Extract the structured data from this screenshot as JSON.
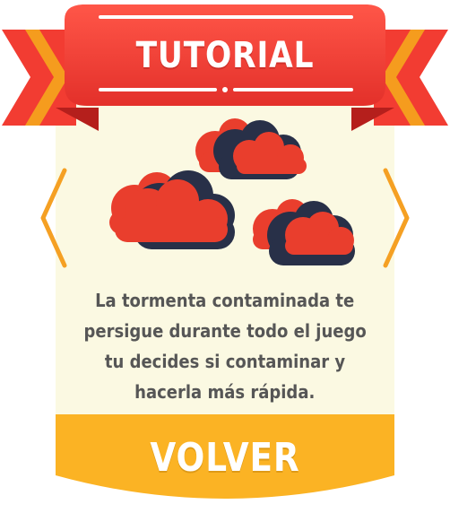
{
  "panel": {
    "title": "TUTORIAL",
    "message_lines": [
      "La tormenta contaminada te",
      "persigue durante todo el juego",
      "tu decides si contaminar y",
      "hacerla más rápida."
    ],
    "button_label": "VOLVER"
  },
  "icons": {
    "left_arrow": "chevron-left-icon",
    "right_arrow": "chevron-right-icon",
    "illustration": "storm-clouds"
  },
  "colors": {
    "ribbon_red": "#f23c32",
    "ribbon_dark": "#cf2b26",
    "cream": "#fbf9e2",
    "accent_orange": "#f5a023",
    "button_yellow": "#fbb324",
    "cloud_red": "#e93e2d",
    "cloud_navy": "#283048",
    "text_gray": "#565656"
  }
}
